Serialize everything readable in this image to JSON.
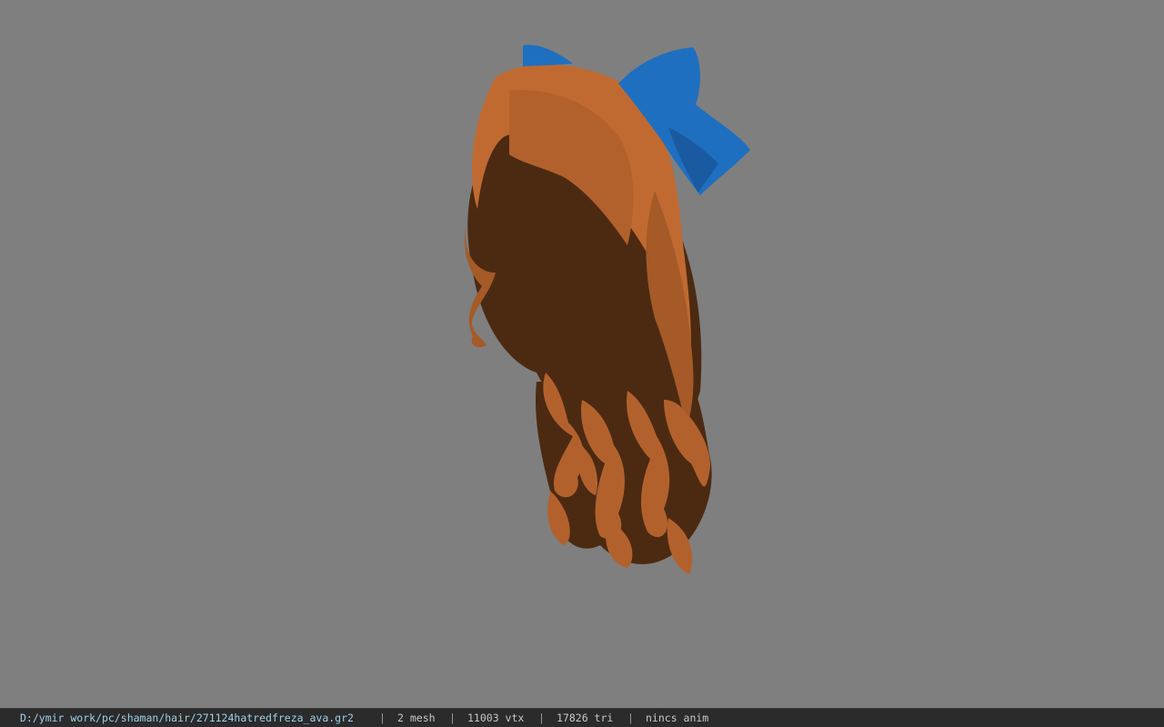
{
  "viewport": {
    "background_color": "#7f7f7f",
    "model": {
      "hair_light_color": "#c06a31",
      "hair_mid_color": "#a55a27",
      "hair_shadow_color": "#4c2a12",
      "bow_color": "#1f6fc0",
      "bow_shadow_color": "#1a5aa0"
    }
  },
  "status_bar": {
    "file_path": "D:/ymir work/pc/shaman/hair/271124hatredfreza_ava.gr2",
    "sep": "|",
    "mesh_count": "2 mesh",
    "vertex_count": "11003 vtx",
    "triangle_count": "17826 tri",
    "anim_label": "nincs anim"
  }
}
